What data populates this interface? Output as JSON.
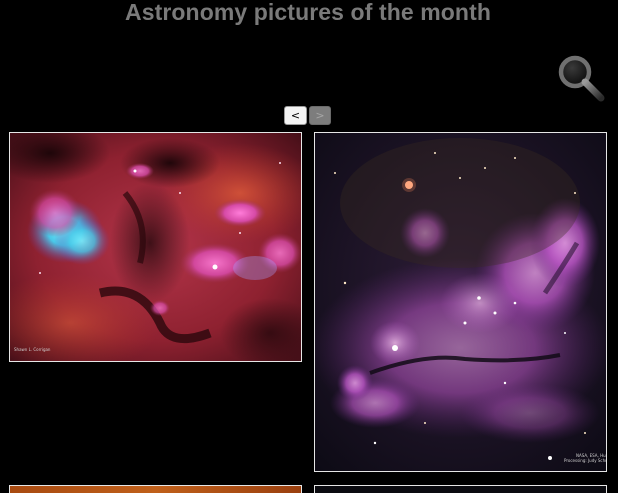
{
  "page": {
    "title": "Astronomy pictures of the month"
  },
  "search": {
    "icon": "magnifier-icon"
  },
  "pager": {
    "prev_label": "<",
    "next_label": ">",
    "next_disabled": true
  },
  "gallery": {
    "items": [
      {
        "name": "nebula-red-cyan",
        "credit": "Shawn L. Corrigan"
      },
      {
        "name": "nebula-pink-star-cluster",
        "credit": "NASA, ESA, Hubble\nProcessing: Judy Schmidt"
      },
      {
        "name": "nebula-orange-partial",
        "credit": ""
      },
      {
        "name": "nebula-dark-partial",
        "credit": ""
      }
    ]
  },
  "colors": {
    "background": "#000000",
    "title": "#7a7a7a",
    "thumb_border": "#e6e6e6"
  }
}
